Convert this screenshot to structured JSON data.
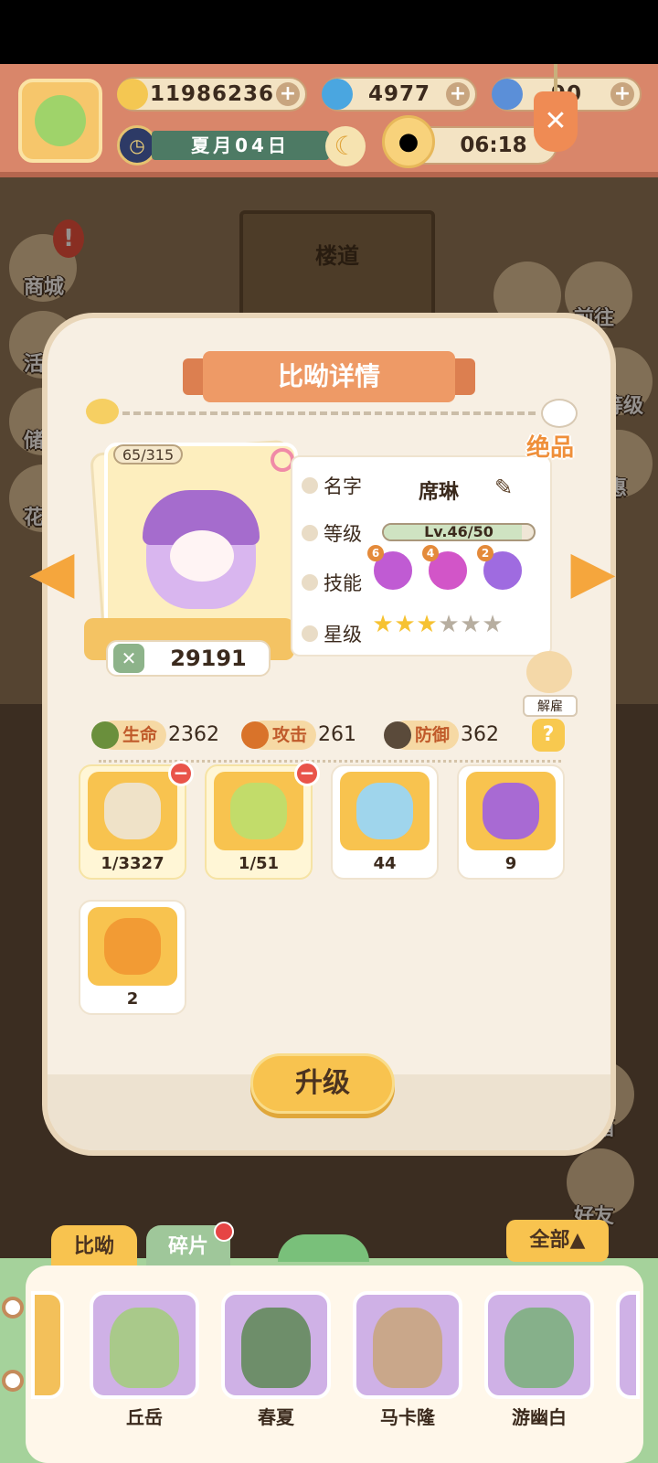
{
  "resources": {
    "bananas": "11986236",
    "flames": "4977",
    "blue_bananas": "90"
  },
  "date": {
    "text": "夏月04日"
  },
  "timer": "06:18",
  "scene": {
    "corridor_label": "楼道"
  },
  "side_buttons": {
    "left": [
      {
        "label": "商城"
      },
      {
        "label": "活"
      },
      {
        "label": "储"
      },
      {
        "label": "花"
      }
    ],
    "right": [
      {
        "label": "前往"
      },
      {
        "label": "等级"
      },
      {
        "label": "惠"
      },
      {
        "label": "邮箱"
      },
      {
        "label": "好友"
      }
    ]
  },
  "panel": {
    "title": "比呦详情",
    "rarity": "绝品",
    "fragments": "65/315",
    "power": "29191",
    "labels": {
      "name": "名字",
      "level": "等级",
      "skills": "技能",
      "stars": "星级"
    },
    "name": "席琳",
    "level_text": "Lv.46/50",
    "level_progress": 0.92,
    "skills": [
      {
        "level": "6",
        "color": "#c05bd3"
      },
      {
        "level": "4",
        "color": "#d255c8"
      },
      {
        "level": "2",
        "color": "#9f6be0"
      }
    ],
    "stars_total": 6,
    "stars_filled": 3,
    "dismiss_label": "解雇",
    "stats": [
      {
        "label": "生命",
        "value": "2362"
      },
      {
        "label": "攻击",
        "value": "261"
      },
      {
        "label": "防御",
        "value": "362"
      }
    ],
    "help": "?",
    "items": [
      {
        "count": "1/3327",
        "selected": true,
        "color": "#efe2c8"
      },
      {
        "count": "1/51",
        "selected": true,
        "color": "#c2dc6a"
      },
      {
        "count": "44",
        "selected": false,
        "color": "#9fd5ec"
      },
      {
        "count": "9",
        "selected": false,
        "color": "#a86ad3"
      },
      {
        "count": "2",
        "selected": false,
        "color": "#f29b34"
      }
    ],
    "upgrade_label": "升级"
  },
  "bottom": {
    "tabs": [
      "比呦",
      "碎片"
    ],
    "filter": "全部▲",
    "characters": [
      {
        "name": "丘岳",
        "color": "#a9c98a"
      },
      {
        "name": "春夏",
        "color": "#6e8e6a"
      },
      {
        "name": "马卡隆",
        "color": "#c9a78a"
      },
      {
        "name": "游幽白",
        "color": "#86b08a"
      }
    ]
  }
}
